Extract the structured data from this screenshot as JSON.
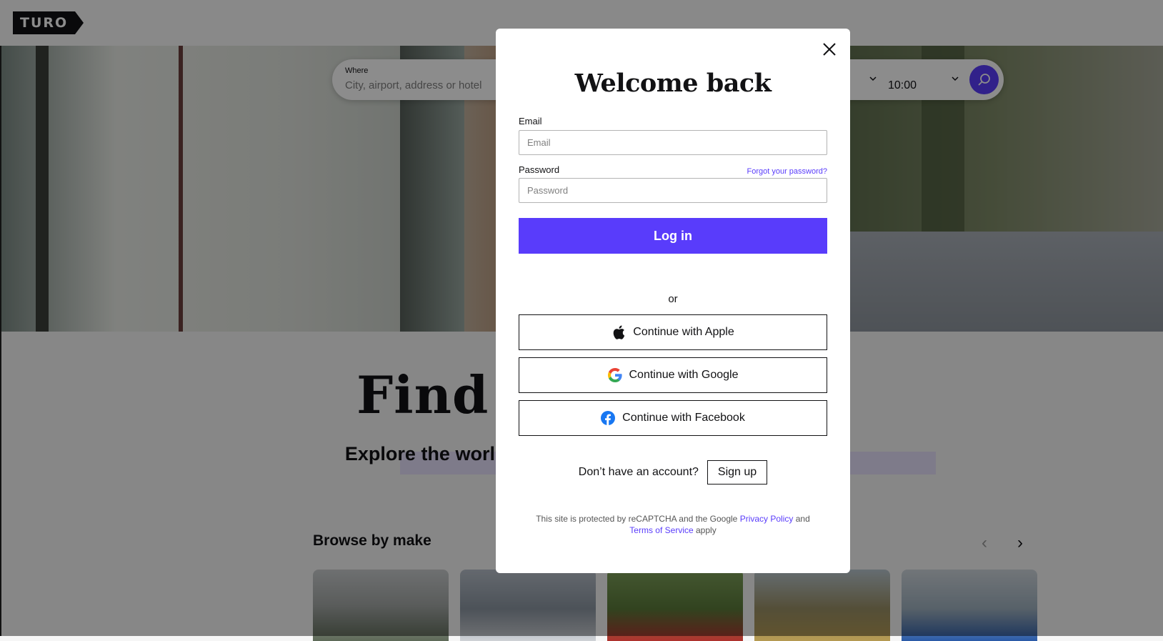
{
  "header": {
    "logo_text": "TURO"
  },
  "search": {
    "where_label": "Where",
    "where_placeholder": "City, airport, address or hotel",
    "until_time": "10:00"
  },
  "hero": {
    "headline": "Find your drive",
    "subheadline": "Explore the world's largest car sharing marketplace"
  },
  "browse": {
    "title": "Browse by make"
  },
  "modal": {
    "title": "Welcome back",
    "email_label": "Email",
    "email_placeholder": "Email",
    "password_label": "Password",
    "password_placeholder": "Password",
    "forgot_link": "Forgot your password?",
    "login_button": "Log in",
    "or_text": "or",
    "apple_button": "Continue with Apple",
    "google_button": "Continue with Google",
    "facebook_button": "Continue with Facebook",
    "signup_prompt": "Don’t have an account?",
    "signup_button": "Sign up",
    "recaptcha_prefix": "This site is protected by reCAPTCHA and the Google",
    "privacy_link": "Privacy Policy",
    "recaptcha_and": "and",
    "terms_link": "Terms of Service",
    "recaptcha_suffix": "apply"
  },
  "colors": {
    "accent": "#593cfb",
    "text": "#121214"
  }
}
